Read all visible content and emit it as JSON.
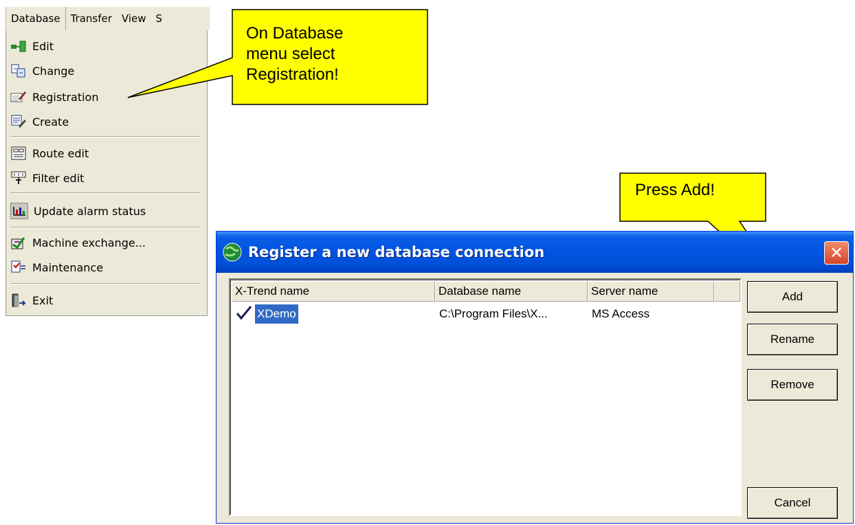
{
  "menubar": {
    "items": [
      "Database",
      "Transfer",
      "View",
      "S"
    ]
  },
  "menu": {
    "items": [
      {
        "label": "Edit",
        "icon": "edit-icon"
      },
      {
        "label": "Change",
        "icon": "change-icon"
      },
      {
        "label": "Registration",
        "icon": "registration-icon"
      },
      {
        "label": "Create",
        "icon": "create-icon"
      },
      {
        "label": "Route edit",
        "icon": "route-edit-icon"
      },
      {
        "label": "Filter edit",
        "icon": "filter-edit-icon"
      },
      {
        "label": "Update alarm status",
        "icon": "alarm-status-icon"
      },
      {
        "label": "Machine exchange...",
        "icon": "machine-exchange-icon"
      },
      {
        "label": "Maintenance",
        "icon": "maintenance-icon"
      },
      {
        "label": "Exit",
        "icon": "exit-icon"
      }
    ]
  },
  "callouts": {
    "menu_hint": "On Database\nmenu select\nRegistration!",
    "add_hint": "Press Add!",
    "fill_color": "#ffff00"
  },
  "dialog": {
    "title": "Register a new database connection",
    "columns": [
      "X-Trend name",
      "Database name",
      "Server name"
    ],
    "rows": [
      {
        "name": "XDemo",
        "database": "C:\\Program Files\\X...",
        "server": "MS Access"
      }
    ],
    "buttons": {
      "add": "Add",
      "rename": "Rename",
      "remove": "Remove",
      "cancel": "Cancel"
    },
    "title_color": "#0054e3",
    "selection_color": "#316ac5"
  }
}
